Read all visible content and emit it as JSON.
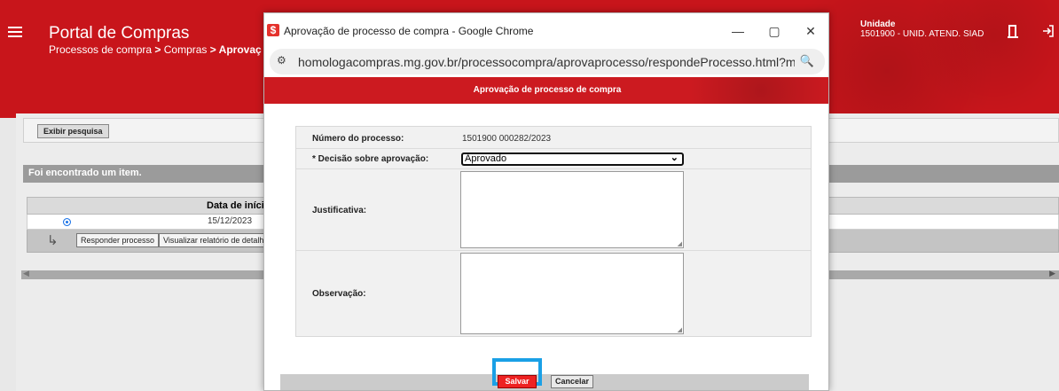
{
  "portal": {
    "title": "Portal de Compras",
    "breadcrumb_part1": "Processos de compra",
    "breadcrumb_sep1": " > ",
    "breadcrumb_part2": "Compras",
    "breadcrumb_sep2": " > ",
    "breadcrumb_part3": "Aprovação",
    "unit_label": "Unidade",
    "unit_value": "1501900 - UNID. ATEND. SIAD",
    "icons": [
      "menu-icon",
      "door-icon",
      "logout-icon"
    ]
  },
  "search": {
    "button": "Exibir pesquisa"
  },
  "results": {
    "found_text": "Foi encontrado um item.",
    "column_header": "Data de início",
    "rows": [
      {
        "date": "15/12/2023",
        "selected": true
      }
    ],
    "actions": {
      "respond": "Responder processo",
      "report": "Visualizar relatório de detalhe"
    }
  },
  "popup": {
    "window_title": "Aprovação de processo de compra - Google Chrome",
    "url": "homologacompras.mg.gov.br/processocompra/aprovaprocesso/respondeProcesso.html?metodo=a...",
    "header": "Aprovação de processo de compra",
    "form": {
      "process_label": "Número do processo:",
      "process_value": "1501900 000282/2023",
      "decision_label": "* Decisão sobre aprovação:",
      "decision_value": "Aprovado",
      "justification_label": "Justificativa:",
      "justification_value": "",
      "observation_label": "Observação:",
      "observation_value": ""
    },
    "buttons": {
      "save": "Salvar",
      "cancel": "Cancelar"
    }
  },
  "colors": {
    "brand_red": "#c8151b",
    "highlight_blue": "#1aa0e6",
    "save_red": "#e22222"
  }
}
